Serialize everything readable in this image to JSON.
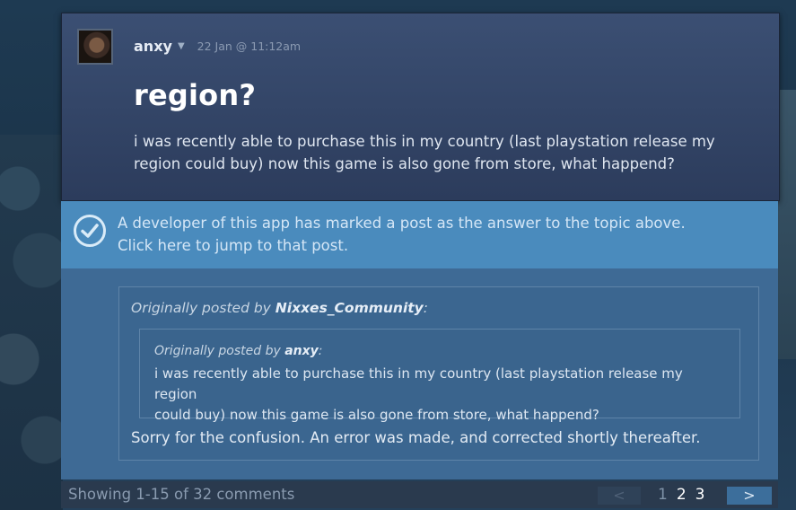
{
  "post": {
    "author": "anxy",
    "timestamp": "22 Jan @ 11:12am",
    "title": "region?",
    "body": "i was recently able to purchase this in my country (last playstation release my region could buy) now this game is also gone from store, what happend?"
  },
  "answer_banner": {
    "line1": "A developer of this app has marked a post as the answer to the topic above.",
    "line2": "Click here to jump to that post."
  },
  "answer_post": {
    "quote_prefix": "Originally posted by ",
    "quote_author": "Nixxes_Community",
    "quote_suffix": ":",
    "inner_quote_prefix": "Originally posted by ",
    "inner_quote_author": "anxy",
    "inner_quote_suffix": ":",
    "inner_quote_line1": "i was recently able to purchase this in my country (last playstation release my region",
    "inner_quote_line2": "could buy) now this game is also gone from store, what happend?",
    "reply": "Sorry for the confusion. An error was made, and corrected shortly thereafter."
  },
  "footer": {
    "showing": "Showing 1-15 of 32 comments",
    "prev": "<",
    "pages": [
      "1",
      "2",
      "3"
    ],
    "current_page": "1",
    "next": ">"
  },
  "icons": {
    "caret": "caret-down-icon",
    "check": "check-circle-icon"
  }
}
